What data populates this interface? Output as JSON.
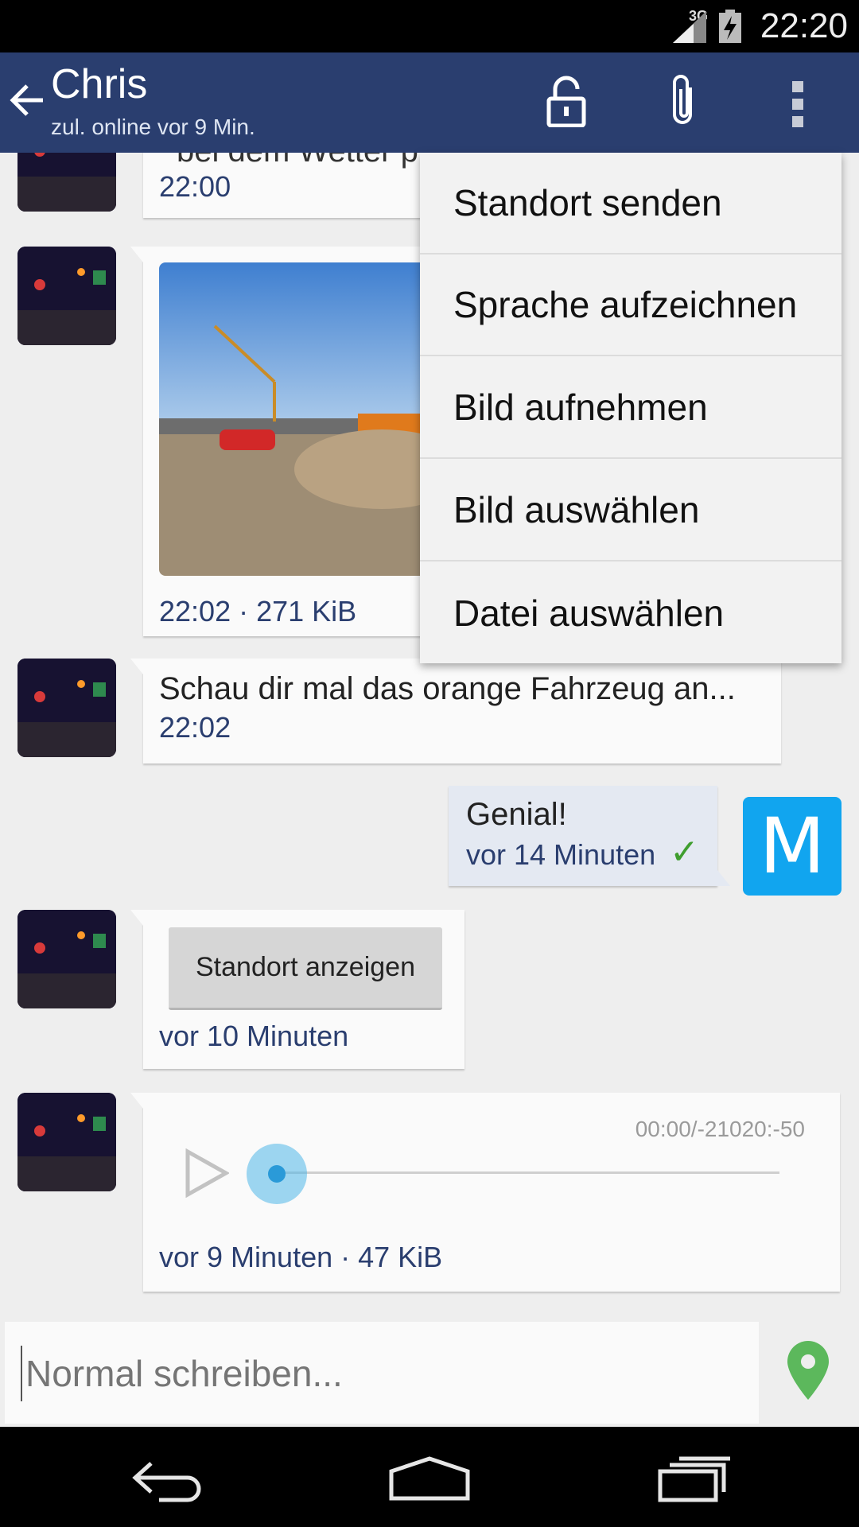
{
  "status_bar": {
    "network": "3G",
    "time": "22:20"
  },
  "app_bar": {
    "contact_name": "Chris",
    "last_seen": "zul. online vor 9 Min."
  },
  "messages": [
    {
      "direction": "in",
      "text_partial": "bei dem Wetter p",
      "meta": "22:00"
    },
    {
      "direction": "in",
      "type": "image",
      "meta": "22:02 · 271 KiB"
    },
    {
      "direction": "in",
      "text": "Schau dir mal das orange Fahrzeug an...",
      "meta": "22:02"
    },
    {
      "direction": "out",
      "text": "Genial!",
      "meta": "vor 14 Minuten",
      "avatar_letter": "M"
    },
    {
      "direction": "in",
      "type": "location",
      "button_label": "Standort anzeigen",
      "meta": "vor 10 Minuten"
    },
    {
      "direction": "in",
      "type": "audio",
      "audio_time": "00:00/-21020:-50",
      "meta": "vor 9 Minuten · 47 KiB",
      "progress": 0
    }
  ],
  "composer": {
    "placeholder": "Normal schreiben..."
  },
  "attach_menu": [
    "Standort senden",
    "Sprache aufzeichnen",
    "Bild aufnehmen",
    "Bild auswählen",
    "Datei auswählen"
  ],
  "colors": {
    "app_bar": "#2a3e6f",
    "accent_blue": "#11a5ef",
    "check_green": "#3f9e2f",
    "pin_green": "#5cb85c"
  },
  "icons": [
    "back-arrow-icon",
    "lock-icon",
    "paperclip-icon",
    "overflow-menu-icon",
    "play-icon",
    "location-pin-icon",
    "nav-back-icon",
    "nav-home-icon",
    "nav-recents-icon"
  ]
}
